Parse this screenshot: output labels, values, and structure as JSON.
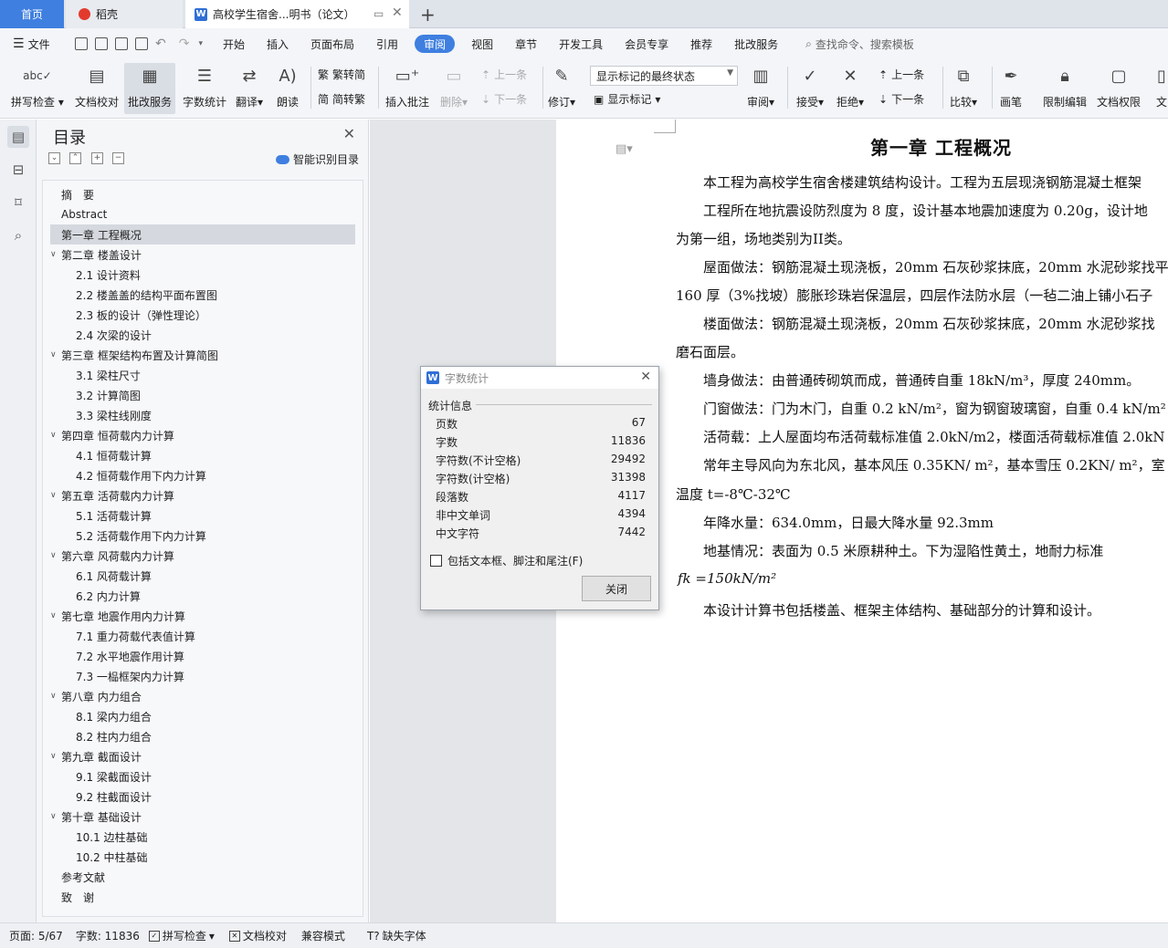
{
  "tabs": {
    "home": "首页",
    "daoke": "稻壳",
    "doc": "高校学生宿舍...明书（论文）"
  },
  "menu": {
    "file": "文件",
    "items": [
      "开始",
      "插入",
      "页面布局",
      "引用",
      "审阅",
      "视图",
      "章节",
      "开发工具",
      "会员专享",
      "推荐",
      "批改服务"
    ],
    "search": "查找命令、搜索模板"
  },
  "ribbon": {
    "spell": "拼写检查",
    "proof": "文档校对",
    "correct": "批改服务",
    "wordcount": "字数统计",
    "translate": "翻译",
    "read": "朗读",
    "to_trad": "繁转简",
    "to_simp": "简转繁",
    "insert_comment": "插入批注",
    "delete": "删除",
    "prev": "上一条",
    "next": "下一条",
    "revise": "修订",
    "markup_state": "显示标记的最终状态",
    "show_markup": "显示标记",
    "review": "审阅",
    "accept": "接受",
    "reject": "拒绝",
    "prev2": "上一条",
    "next2": "下一条",
    "compare": "比较",
    "pen": "画笔",
    "restrict": "限制编辑",
    "permission": "文档权限",
    "more": "文"
  },
  "toc": {
    "title": "目录",
    "smart": "智能识别目录",
    "items": [
      {
        "label": "摘　要",
        "level": 1,
        "chev": false
      },
      {
        "label": "Abstract",
        "level": 1,
        "chev": false
      },
      {
        "label": "第一章  工程概况",
        "level": 1,
        "chev": false,
        "selected": true
      },
      {
        "label": "第二章  楼盖设计",
        "level": 1,
        "chev": true
      },
      {
        "label": "2.1  设计资料",
        "level": 2
      },
      {
        "label": "2.2  楼盖盖的结构平面布置图",
        "level": 2
      },
      {
        "label": "2.3  板的设计（弹性理论）",
        "level": 2
      },
      {
        "label": "2.4  次梁的设计",
        "level": 2
      },
      {
        "label": "第三章  框架结构布置及计算简图",
        "level": 1,
        "chev": true
      },
      {
        "label": "3.1  梁柱尺寸",
        "level": 2
      },
      {
        "label": "3.2  计算简图",
        "level": 2
      },
      {
        "label": "3.3  梁柱线刚度",
        "level": 2
      },
      {
        "label": "第四章  恒荷载内力计算",
        "level": 1,
        "chev": true
      },
      {
        "label": "4.1  恒荷载计算",
        "level": 2
      },
      {
        "label": "4.2  恒荷载作用下内力计算",
        "level": 2
      },
      {
        "label": "第五章  活荷载内力计算",
        "level": 1,
        "chev": true
      },
      {
        "label": "5.1  活荷载计算",
        "level": 2
      },
      {
        "label": "5.2  活荷载作用下内力计算",
        "level": 2
      },
      {
        "label": "第六章  风荷载内力计算",
        "level": 1,
        "chev": true
      },
      {
        "label": "6.1  风荷载计算",
        "level": 2
      },
      {
        "label": "6.2  内力计算",
        "level": 2
      },
      {
        "label": "第七章  地震作用内力计算",
        "level": 1,
        "chev": true
      },
      {
        "label": "7.1  重力荷载代表值计算",
        "level": 2
      },
      {
        "label": "7.2  水平地震作用计算",
        "level": 2
      },
      {
        "label": "7.3  一榀框架内力计算",
        "level": 2
      },
      {
        "label": "第八章  内力组合",
        "level": 1,
        "chev": true
      },
      {
        "label": "8.1  梁内力组合",
        "level": 2
      },
      {
        "label": "8.2  柱内力组合",
        "level": 2
      },
      {
        "label": "第九章  截面设计",
        "level": 1,
        "chev": true
      },
      {
        "label": "9.1  梁截面设计",
        "level": 2
      },
      {
        "label": "9.2  柱截面设计",
        "level": 2
      },
      {
        "label": "第十章  基础设计",
        "level": 1,
        "chev": true
      },
      {
        "label": "10.1  边柱基础",
        "level": 2
      },
      {
        "label": "10.2  中柱基础",
        "level": 2
      },
      {
        "label": "参考文献",
        "level": 1,
        "chev": false
      },
      {
        "label": "致　谢",
        "level": 1,
        "chev": false
      }
    ]
  },
  "document": {
    "heading": "第一章  工程概况",
    "lines": [
      "本工程为高校学生宿舍楼建筑结构设计。工程为五层现浇钢筋混凝土框架",
      "工程所在地抗震设防烈度为 8 度，设计基本地震加速度为 0.20g，设计地",
      "为第一组，场地类别为II类。",
      "屋面做法：钢筋混凝土现浇板，20mm 石灰砂浆抹底，20mm 水泥砂浆找平",
      "160 厚（3%找坡）膨胀珍珠岩保温层，四层作法防水层（一毡二油上铺小石子",
      "楼面做法：钢筋混凝土现浇板，20mm 石灰砂浆抹底，20mm 水泥砂浆找",
      "磨石面层。",
      "墙身做法：由普通砖砌筑而成，普通砖自重 18kN/m³，厚度 240mm。",
      "门窗做法：门为木门，自重 0.2 kN/m²，窗为钢窗玻璃窗，自重 0.4 kN/m²",
      "活荷载：上人屋面均布活荷载标准值 2.0kN/m2，楼面活荷载标准值 2.0kN",
      "常年主导风向为东北风，基本风压 0.35KN/ m²，基本雪压 0.2KN/ m²，室",
      "温度 t=-8℃-32℃",
      "年降水量：634.0mm，日最大降水量 92.3mm",
      "地基情况：表面为 0.5 米原耕种土。下为湿陷性黄土，地耐力标准",
      "fk =150kN/m²",
      "本设计计算书包括楼盖、框架主体结构、基础部分的计算和设计。"
    ]
  },
  "dialog": {
    "title": "字数统计",
    "group": "统计信息",
    "stats": [
      {
        "label": "页数",
        "value": "67"
      },
      {
        "label": "字数",
        "value": "11836"
      },
      {
        "label": "字符数(不计空格)",
        "value": "29492"
      },
      {
        "label": "字符数(计空格)",
        "value": "31398"
      },
      {
        "label": "段落数",
        "value": "4117"
      },
      {
        "label": "非中文单词",
        "value": "4394"
      },
      {
        "label": "中文字符",
        "value": "7442"
      }
    ],
    "include_label": "包括文本框、脚注和尾注(F)",
    "close": "关闭"
  },
  "status": {
    "page": "页面: 5/67",
    "words": "字数: 11836",
    "spell": "拼写检查",
    "proof": "文档校对",
    "compat": "兼容模式",
    "missing_font": "缺失字体"
  },
  "colors": {
    "accent": "#3f7fe0",
    "doc_bg": "#e3e5e8"
  }
}
